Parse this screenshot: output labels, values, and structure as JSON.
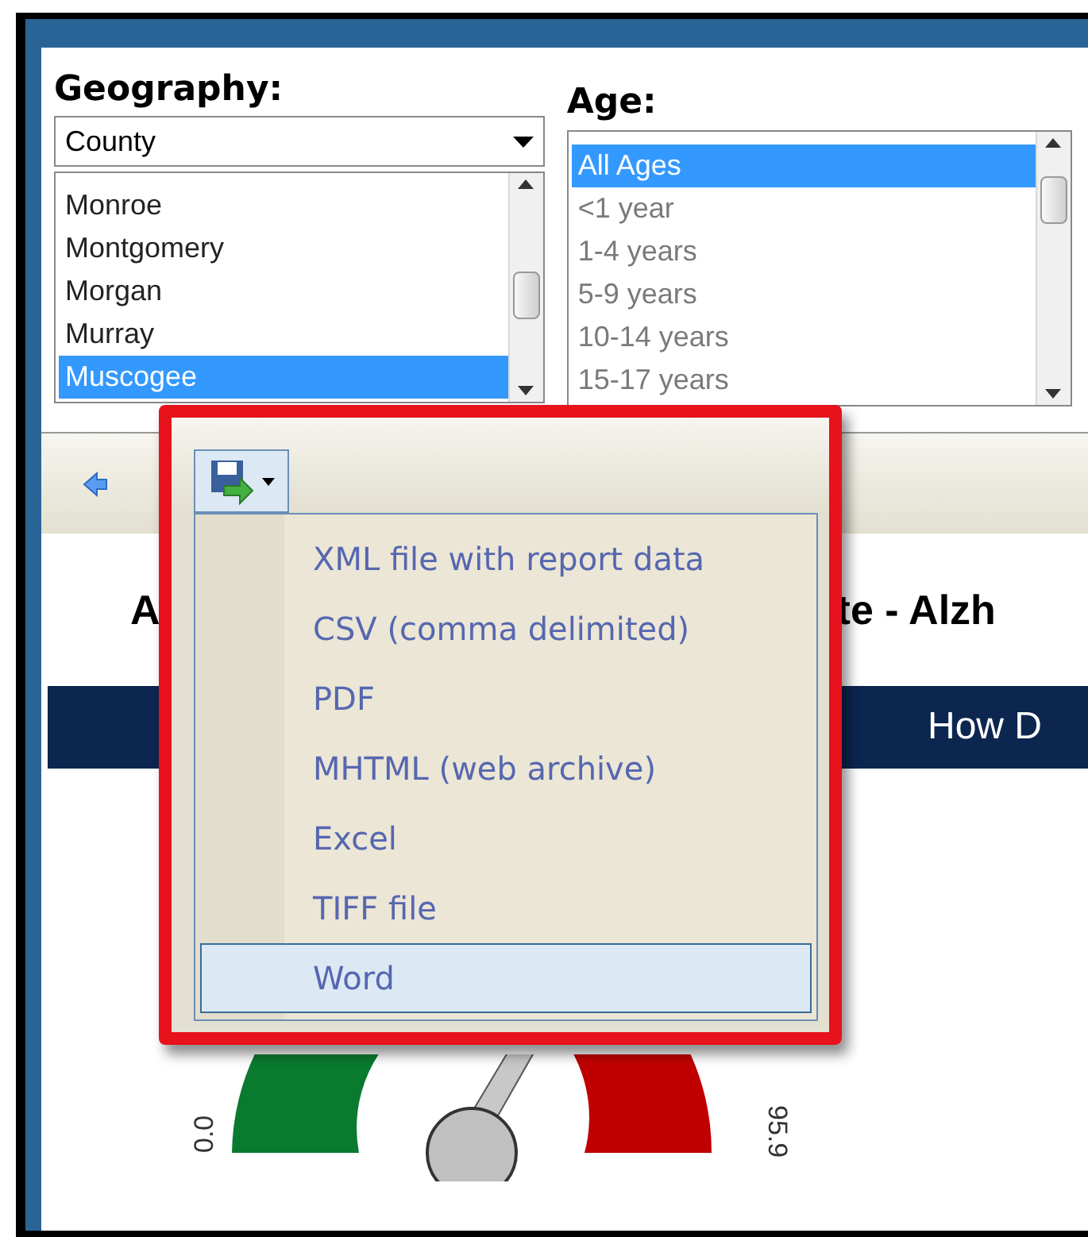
{
  "geography": {
    "label": "Geography:",
    "dropdown": {
      "value": "County"
    },
    "items": [
      {
        "label": "Monroe",
        "selected": false
      },
      {
        "label": "Montgomery",
        "selected": false
      },
      {
        "label": "Morgan",
        "selected": false
      },
      {
        "label": "Murray",
        "selected": false
      },
      {
        "label": "Muscogee",
        "selected": true
      }
    ]
  },
  "age": {
    "label": "Age:",
    "items": [
      {
        "label": "All Ages",
        "selected": true
      },
      {
        "label": "<1 year",
        "selected": false
      },
      {
        "label": "1-4 years",
        "selected": false
      },
      {
        "label": "5-9 years",
        "selected": false
      },
      {
        "label": "10-14 years",
        "selected": false
      },
      {
        "label": "15-17 years",
        "selected": false
      }
    ]
  },
  "export_menu": {
    "items": [
      {
        "label": "XML file with report data",
        "selected": false
      },
      {
        "label": "CSV (comma delimited)",
        "selected": false
      },
      {
        "label": "PDF",
        "selected": false
      },
      {
        "label": "MHTML (web archive)",
        "selected": false
      },
      {
        "label": "Excel",
        "selected": false
      },
      {
        "label": "TIFF file",
        "selected": false
      },
      {
        "label": "Word",
        "selected": true
      }
    ]
  },
  "report": {
    "title_parts": [
      "A",
      "te - Alzh"
    ],
    "header_bar": "How D",
    "gauge": {
      "min_label": "0.0",
      "max_label": "95.9"
    }
  }
}
